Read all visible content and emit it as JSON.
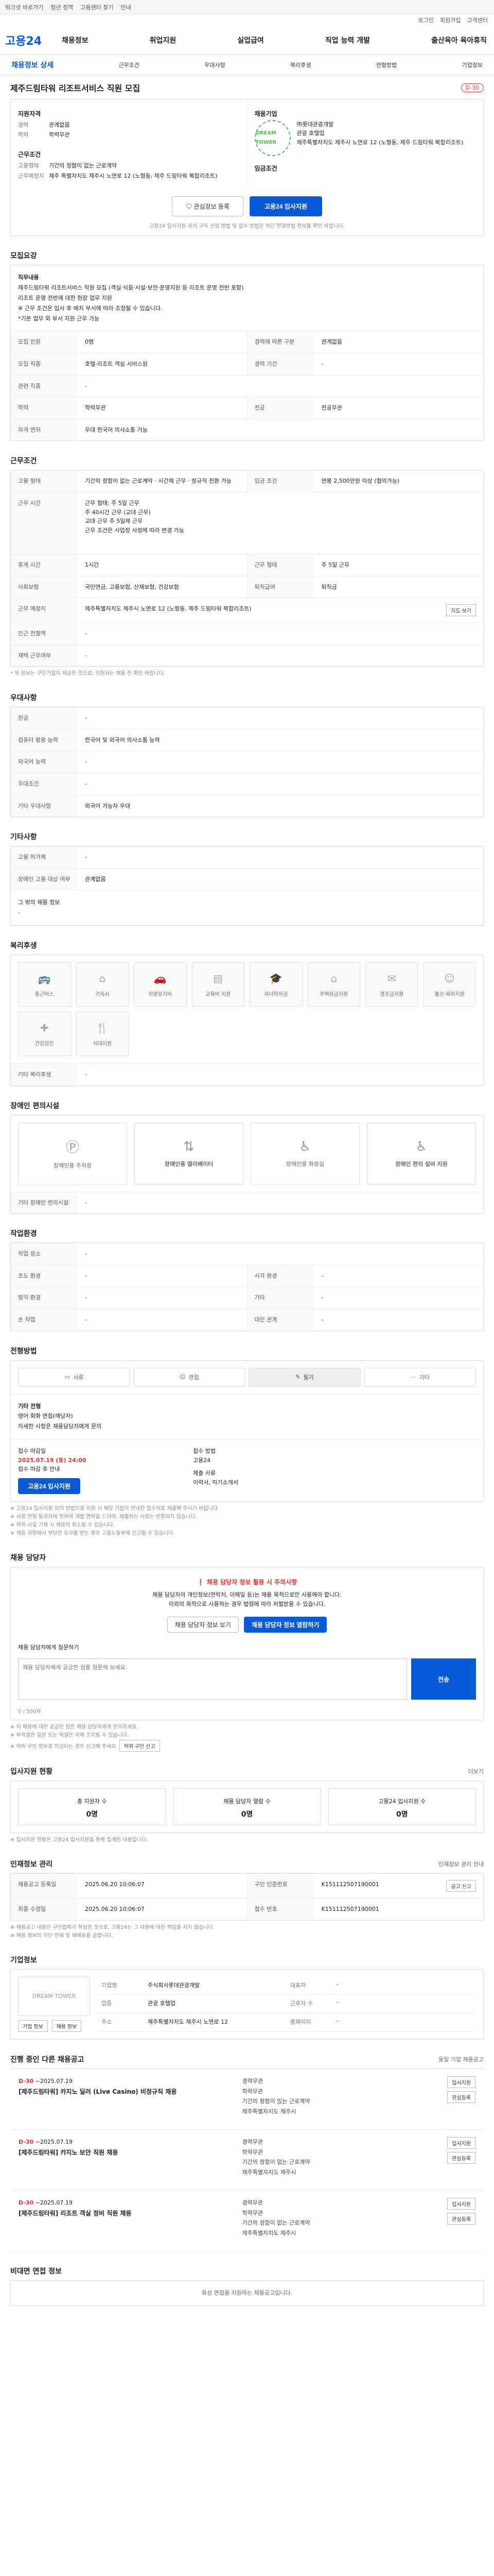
{
  "topbar": {
    "items": [
      "워크넷 바로가기",
      "청년 정책",
      "고용센터 찾기",
      "안내"
    ],
    "right": [
      "로그인",
      "회원가입",
      "고객센터"
    ]
  },
  "gnb": {
    "logo": "고용24",
    "menu": [
      "채용정보",
      "취업지원",
      "실업급여",
      "직업 능력 개발",
      "출산육아 육아휴직"
    ]
  },
  "subnav": {
    "first": "채용정보 상세",
    "items": [
      "근무조건",
      "우대사항",
      "복리후생",
      "전형방법",
      "기업정보"
    ]
  },
  "job": {
    "title": "제주드림타워 리조트서비스 직원 모집",
    "dday": "D-30",
    "summary": {
      "qual_heading": "지원자격",
      "exp_label": "경력",
      "exp_value": "관계없음",
      "edu_label": "학력",
      "edu_value": "학력무관",
      "work_heading": "근무조건",
      "emp_label": "고용형태",
      "emp_value": "기간의 정함이 없는 근로계약",
      "place_label": "근무예정지",
      "place_value": "제주 특별자치도 제주시 노연로 12 (노형동, 제주 드림타워 복합리조트)",
      "company_heading": "채용기업",
      "company_logo_text": "DREAM TOWER",
      "company_name": "㈜롯데관광개발",
      "industry": "관광 호텔업",
      "address": "제주특별자치도 제주시 노연로 12 (노형동, 제주 드림타워 복합리조트)",
      "salary_heading": "임금조건"
    },
    "cta": {
      "scrap": "관심정보 등록",
      "apply": "고용24 입사지원",
      "notice": "고용24 입사지원 외의 구직 신청 방법 및 접수 방법은 하단 전형방법 정보를 확인 바랍니다."
    }
  },
  "recruit": {
    "heading": "모집요강",
    "desc_label": "직무내용",
    "desc": "제주드림타워 리조트서비스 직원 모집 (객실·식음·시설·보안·운영지원 등 리조트 운영 전반 포함)\n리조트 운영 전반에 대한 현장 업무 지원\n※ 근무 조건은 입사 후 배치 부서에 따라 조정될 수 있습니다.\n*기본 업무 외 부서 지원 근무 가능",
    "rows": [
      {
        "k1": "모집 인원",
        "v1": "0명",
        "k2": "경력에 따른 구분",
        "v2": "관계없음"
      },
      {
        "k1": "모집 직종",
        "v1": "호텔·리조트 객실 서비스원",
        "k2": "경력 기간",
        "v2": "-"
      },
      {
        "k1": "관련 직종",
        "v1": "-",
        "k2": "",
        "v2": ""
      },
      {
        "k1": "학력",
        "v1": "학력무관",
        "k2": "전공",
        "v2": "전공무관"
      },
      {
        "k1": "자격 면허",
        "v1": "우대 한국어 의사소통 가능",
        "k2": "",
        "v2": ""
      }
    ]
  },
  "work": {
    "heading": "근무조건",
    "emp_k": "고용 형태",
    "emp_v": "기간의 정함이 없는 근로계약 · 시간제 근무 · 정규직 전환 가능",
    "salary_k": "임금 조건",
    "salary_v": "연봉 2,500만원 이상 (협의가능)",
    "hours_k": "근무 시간",
    "hours_v": "근무 형태: 주 5일 근무\n주 40시간 근무 (교대 근무)\n교대 근무 주 5일제 근무\n근무 조건은 사업장 사정에 따라 변경 가능",
    "rows": [
      {
        "k1": "휴게 시간",
        "v1": "1시간",
        "k2": "근무 형태",
        "v2": "주 5일 근무"
      },
      {
        "k1": "사회보험",
        "v1": "국민연금, 고용보험, 산재보험, 건강보험",
        "k2": "퇴직급여",
        "v2": "퇴직금"
      },
      {
        "k1": "근무 예정지",
        "v1": "제주특별자치도 제주시 노연로 12 (노형동, 제주 드림타워 복합리조트)",
        "k2": "",
        "v2": ""
      },
      {
        "k1": "인근 전철역",
        "v1": "-",
        "k2": "",
        "v2": ""
      },
      {
        "k1": "재택 근무여부",
        "v1": "-",
        "k2": "",
        "v2": ""
      }
    ],
    "map_button": "지도 보기",
    "note": "* 위 정보는 구인기업이 제공한 것으로, 지원자는 채용 전 확인 바랍니다."
  },
  "prefer": {
    "heading": "우대사항",
    "rows": [
      {
        "k": "전공",
        "v": "-"
      },
      {
        "k": "컴퓨터 활용 능력",
        "v": "한국어 및 외국어 의사소통 능력"
      },
      {
        "k": "외국어 능력",
        "v": "-"
      },
      {
        "k": "우대조건",
        "v": "-"
      },
      {
        "k": "기타 우대사항",
        "v": "외국어 가능자 우대"
      }
    ]
  },
  "etc": {
    "heading": "기타사항",
    "rows": [
      {
        "k": "고용 허가제",
        "v": "-"
      },
      {
        "k": "장애인 고용 대상 여부",
        "v": "관계없음"
      }
    ],
    "extra_label": "그 밖의 채용 정보",
    "extra_value": "-"
  },
  "welfare": {
    "heading": "복리후생",
    "items": [
      "통근버스",
      "기숙사",
      "차량유지비",
      "교육비 지원",
      "자녀학자금",
      "주택자금지원",
      "경조금지원",
      "출산·육아지원",
      "건강검진",
      "식대지원"
    ],
    "etc_label": "기타 복리후생",
    "etc_value": "-"
  },
  "disability": {
    "heading": "장애인 편의시설",
    "items": [
      "장애인용 주차장",
      "장애인용 엘리베이터",
      "장애인용 화장실",
      "장애인 편의 설비 지원"
    ],
    "etc_label": "기타 장애인 편의시설",
    "etc_value": "-"
  },
  "environment": {
    "heading": "작업환경",
    "rows": [
      {
        "k1": "작업 장소",
        "v1": "-",
        "k2": "",
        "v2": ""
      },
      {
        "k1": "조도 환경",
        "v1": "-",
        "k2": "시각 환경",
        "v2": "-"
      },
      {
        "k1": "청각 환경",
        "v1": "-",
        "k2": "기타",
        "v2": "-"
      },
      {
        "k1": "손 작업",
        "v1": "-",
        "k2": "대인 관계",
        "v2": "-"
      }
    ]
  },
  "selection": {
    "heading": "전형방법",
    "steps": [
      "서류",
      "면접",
      "필기",
      "기타"
    ],
    "etc_label": "기타 전형",
    "etc_value": "영어 회화 면접(해당자)\n자세한 사항은 채용담당자에게 문의",
    "deadline_label": "접수 마감일",
    "deadline_value": "2025.07.19 (토) 24:00",
    "deadline_note": "접수 마감 후 안내",
    "method_label": "접수 방법",
    "method_value": "고용24",
    "method_btn": "고용24 입사지원",
    "docs_label": "제출 서류",
    "docs_value": "이력서, 자기소개서",
    "notes": [
      "※ 고용24 입사지원 외의 방법으로 지원 시 해당 기업이 안내한 접수처로 제출해 주시기 바랍니다.",
      "※ 서류 전형 통과자에 한하여 개별 연락을 드리며, 제출하신 서류는 반환되지 않습니다.",
      "※ 허위 사실 기재 시 채용이 취소될 수 있습니다.",
      "※ 채용 과정에서 부당한 요구를 받는 경우 고용노동부에 신고할 수 있습니다."
    ]
  },
  "contact": {
    "heading": "채용 담당자",
    "warn_title": "채용 담당자 정보 활용 시 주의사항",
    "warn_text": "채용 담당자의 개인정보(연락처, 이메일 등)는 채용 목적으로만 사용해야 합니다.\n이외의 목적으로 사용하는 경우 법령에 따라 처벌받을 수 있습니다.",
    "btn1": "채용 담당자 정보 보기",
    "btn2": "채용 담당자 정보 열람하기",
    "qa_label": "채용 담당자에게 질문하기",
    "qa_placeholder": "채용 담당자에게 궁금한 점을 질문해 보세요.",
    "qa_count": "0 / 500자",
    "qa_btn": "전송",
    "notes": [
      "※ 이 채용에 대한 궁금한 점은 채용 담당자에게 문의하세요.",
      "※ 부적절한 질문 또는 욕설은 삭제 조치될 수 있습니다.",
      "※ 허위 구인 정보로 의심되는 경우 신고해 주세요."
    ],
    "report_btn": "허위 구인 신고"
  },
  "apply_status": {
    "heading": "입사지원 현황",
    "more": "더보기",
    "stats": [
      {
        "label": "총 지원자 수",
        "value": "0명"
      },
      {
        "label": "채용 담당자 열람 수",
        "value": "0명"
      },
      {
        "label": "고용24 입사지원 수",
        "value": "0명"
      }
    ],
    "note": "※ 입사지원 현황은 고용24 입사지원을 통해 집계된 내용입니다."
  },
  "manage": {
    "heading": "인재정보 관리",
    "more": "인재정보 관리 안내",
    "rows": [
      {
        "k1": "채용공고 등록일",
        "v1": "2025.06.20 10:06:07",
        "k2": "구인 인증번호",
        "v2": "K151112507190001"
      },
      {
        "k1": "최종 수정일",
        "v1": "2025.06.20 10:06:07",
        "k2": "접수 번호",
        "v2": "K151112507190001"
      }
    ],
    "report_btn": "공고 신고",
    "notes": [
      "※ 채용공고 내용은 구인업체가 작성한 것으로, 고용24는 그 내용에 대한 책임을 지지 않습니다.",
      "※ 채용 정보의 무단 전재 및 재배포를 금합니다."
    ]
  },
  "company": {
    "heading": "기업정보",
    "logo_text": "DREAM TOWER",
    "rows": [
      {
        "k1": "기업명",
        "v1": "주식회사롯데관광개발",
        "k2": "대표자",
        "v2": "-"
      },
      {
        "k1": "업종",
        "v1": "관광 호텔업",
        "k2": "근로자 수",
        "v2": "-"
      },
      {
        "k1": "주소",
        "v1": "제주특별자치도 제주시 노연로 12",
        "k2": "홈페이지",
        "v2": "-"
      }
    ],
    "btn1": "기업 정보",
    "btn2": "채용 정보"
  },
  "related": {
    "heading": "진행 중인 다른 채용공고",
    "note": "동일 기업 채용공고",
    "items": [
      {
        "dday": "D-30",
        "period": "~2025.07.19",
        "title": "[제주드림타워] 카지노 딜러 (Live Casino) 비정규직 채용",
        "exp": "경력무관",
        "edu": "학력무관",
        "type": "기간의 정함이 있는 근로계약",
        "place": "제주특별자치도 제주시"
      },
      {
        "dday": "D-30",
        "period": "~2025.07.19",
        "title": "[제주드림타워] 카지노 보안 직원 채용",
        "exp": "경력무관",
        "edu": "학력무관",
        "type": "기간의 정함이 없는 근로계약",
        "place": "제주특별자치도 제주시"
      },
      {
        "dday": "D-30",
        "period": "~2025.07.19",
        "title": "[제주드림타워] 리조트 객실 정비 직원 채용",
        "exp": "경력무관",
        "edu": "학력무관",
        "type": "기간의 정함이 없는 근로계약",
        "place": "제주특별자치도 제주시"
      }
    ],
    "btn_apply": "입사지원",
    "btn_scrap": "관심등록"
  },
  "footer_sec": {
    "heading": "비대면 면접 정보",
    "text": "화상 면접을 지원하는 채용공고입니다."
  }
}
